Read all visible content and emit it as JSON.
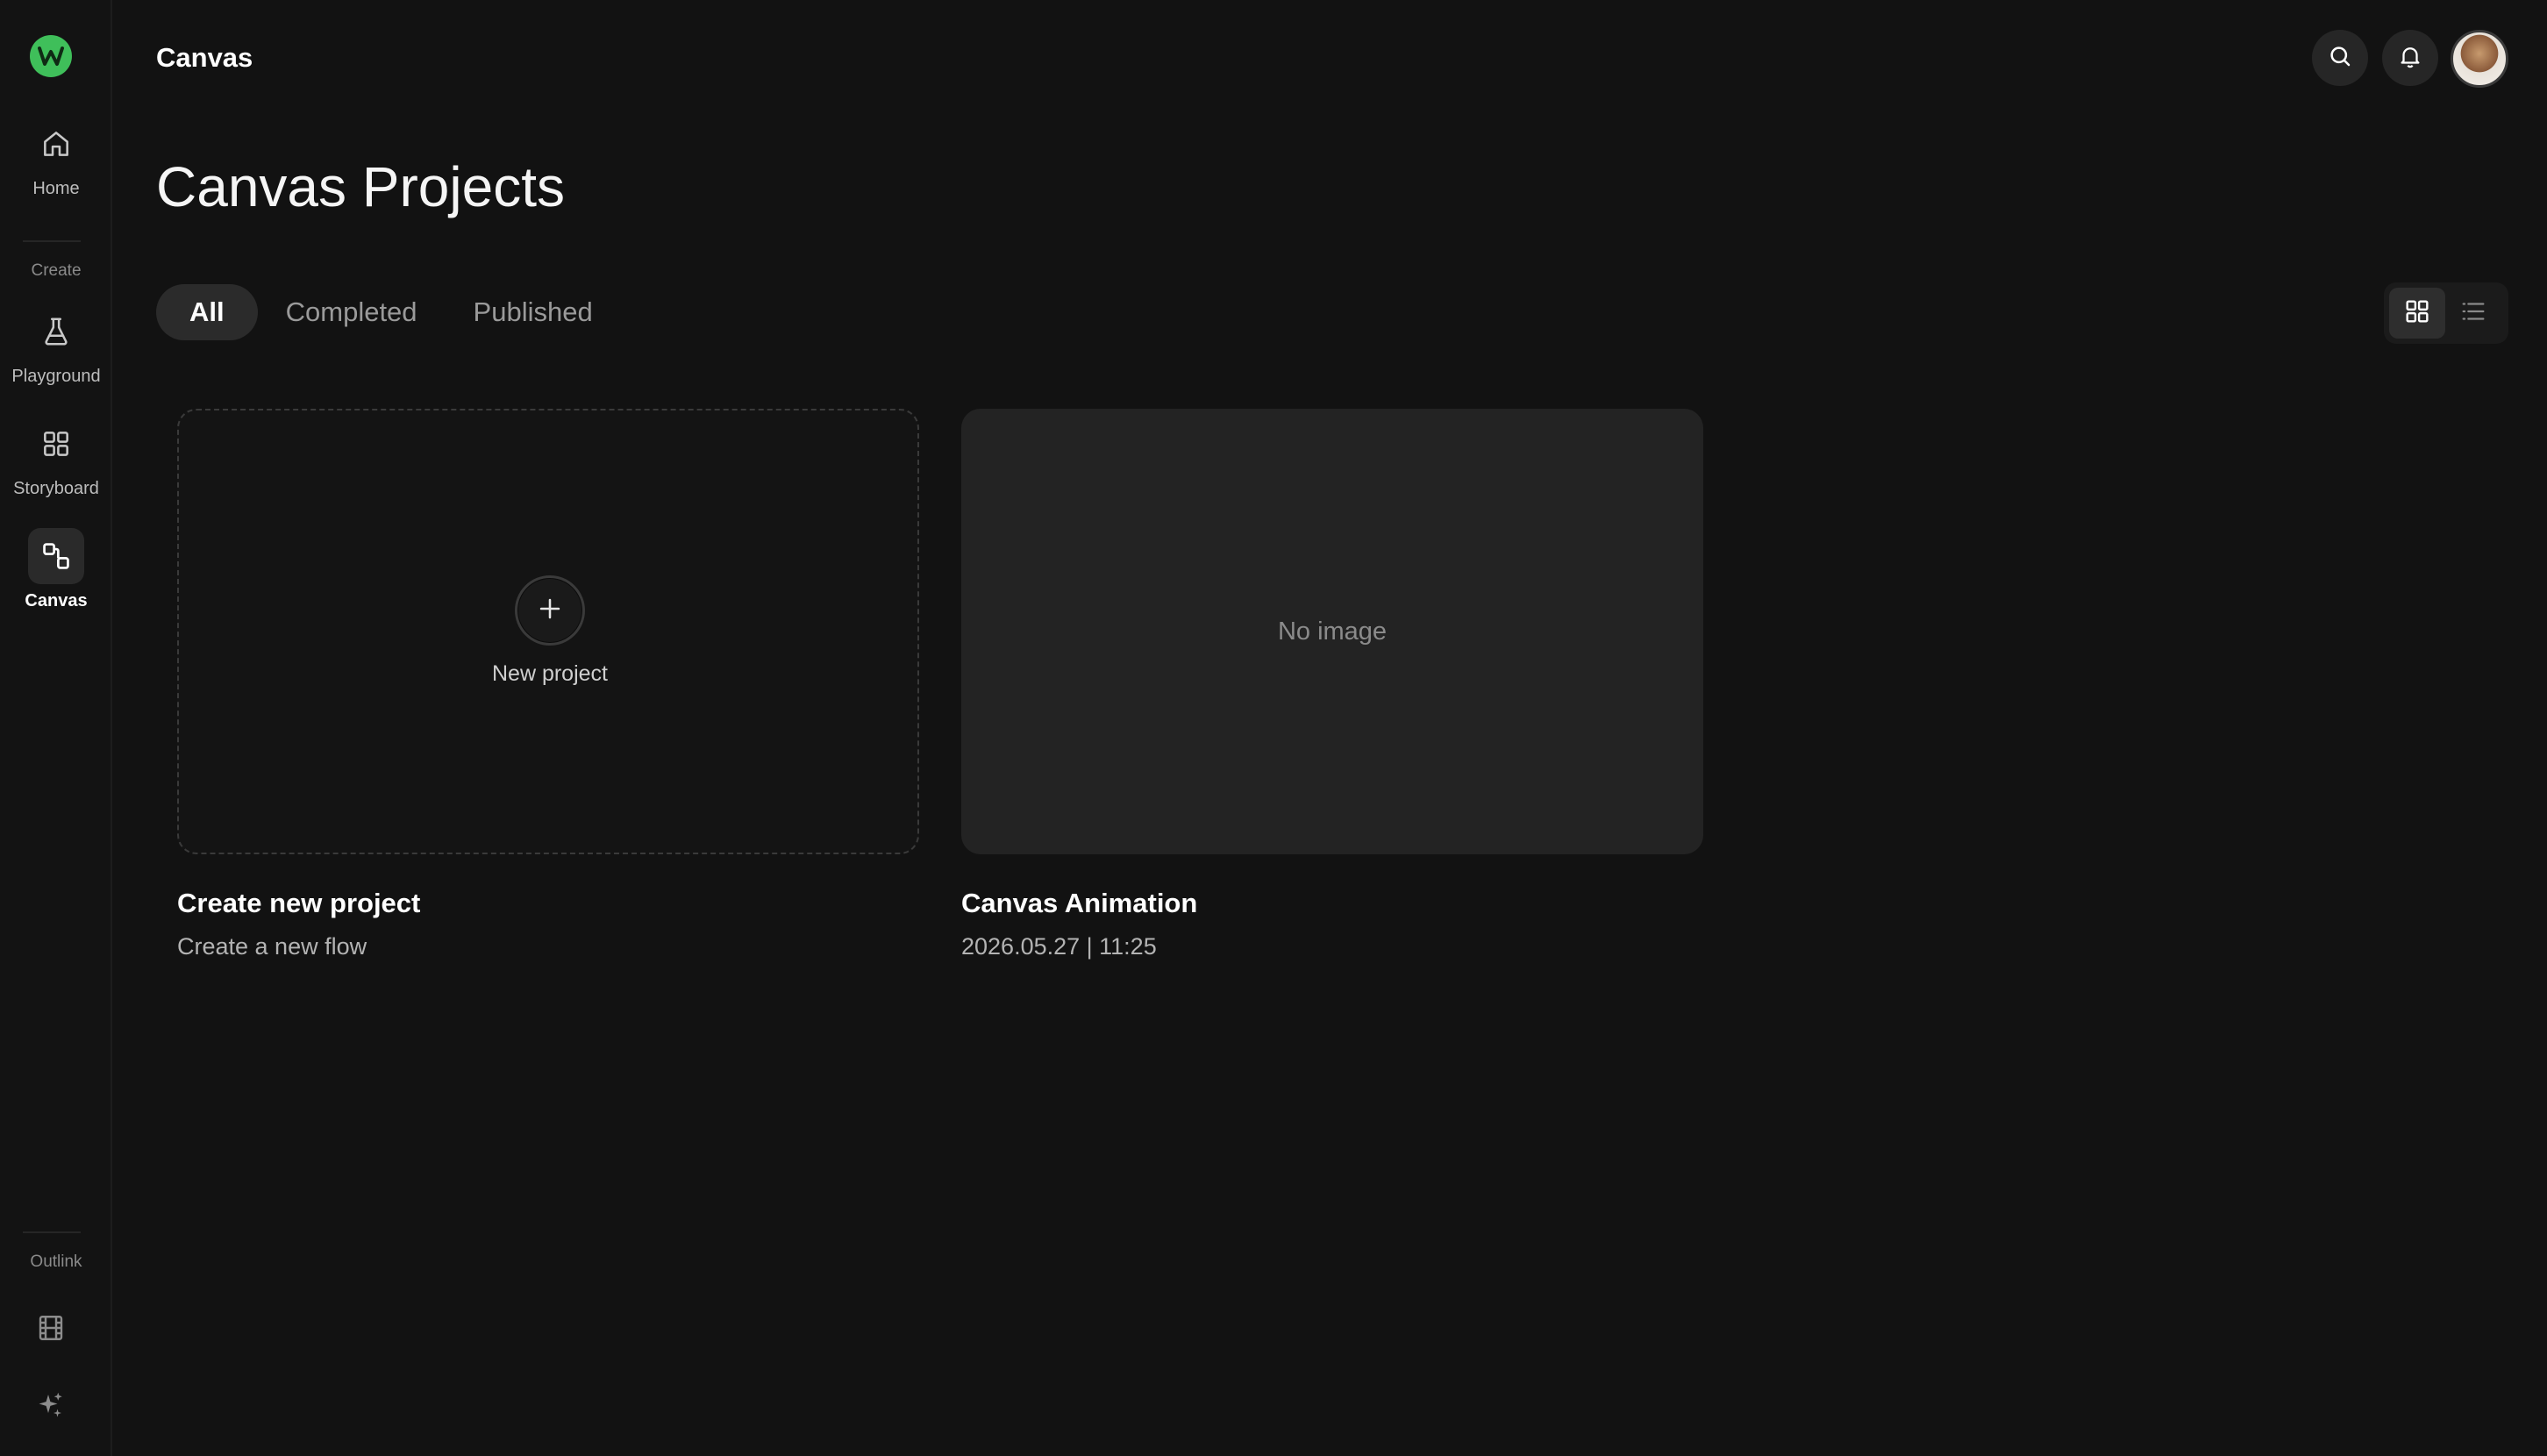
{
  "header": {
    "title": "Canvas"
  },
  "page": {
    "title": "Canvas Projects"
  },
  "sidebar": {
    "items": [
      {
        "label": "Home"
      },
      {
        "label": "Playground"
      },
      {
        "label": "Storyboard"
      },
      {
        "label": "Canvas"
      }
    ],
    "sections": {
      "create": "Create",
      "outlink": "Outlink"
    }
  },
  "tabs": [
    {
      "label": "All"
    },
    {
      "label": "Completed"
    },
    {
      "label": "Published"
    }
  ],
  "cards": [
    {
      "center_label": "New project",
      "title": "Create new project",
      "subtitle": "Create a new flow"
    },
    {
      "placeholder": "No image",
      "title": "Canvas Animation",
      "subtitle": "2026.05.27 | 11:25"
    }
  ],
  "colors": {
    "accent": "#3fbf5a",
    "background": "#121212",
    "card": "#232323"
  }
}
